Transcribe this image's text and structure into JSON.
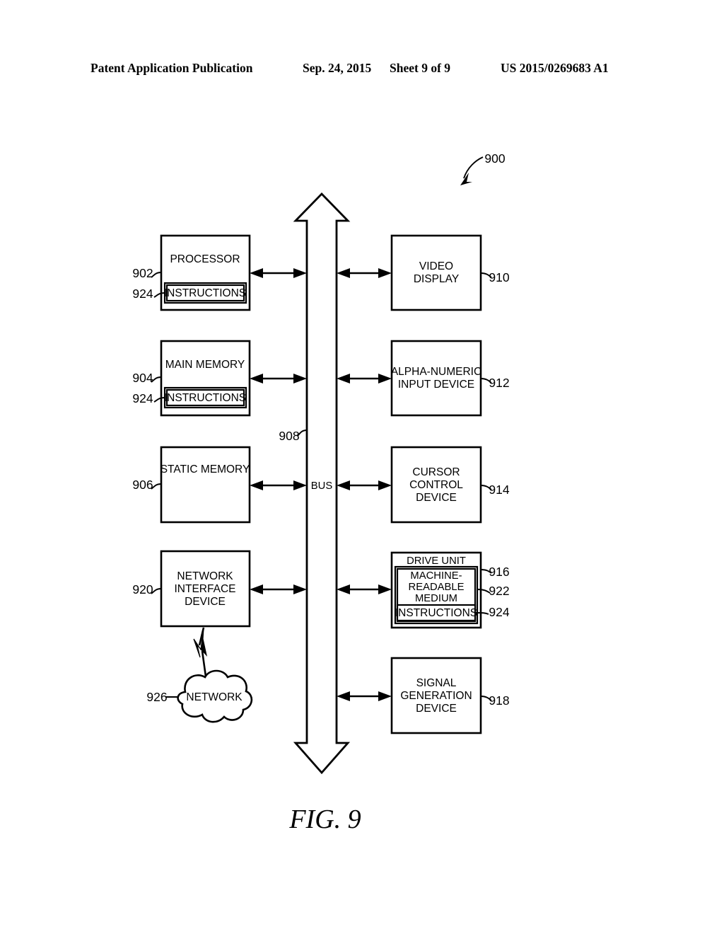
{
  "header": {
    "publication": "Patent Application Publication",
    "date": "Sep. 24, 2015",
    "sheet": "Sheet 9 of 9",
    "patent_number": "US 2015/0269683 A1"
  },
  "figure": {
    "caption": "FIG. 9",
    "system_ref": "900",
    "bus_label": "BUS",
    "bus_ref": "908"
  },
  "left_column": [
    {
      "title": "PROCESSOR",
      "ref": "902",
      "inner_label": "INSTRUCTIONS",
      "inner_ref": "924"
    },
    {
      "title": "MAIN MEMORY",
      "ref": "904",
      "inner_label": "INSTRUCTIONS",
      "inner_ref": "924"
    },
    {
      "title": "STATIC MEMORY",
      "ref": "906"
    },
    {
      "title_line1": "NETWORK",
      "title_line2": "INTERFACE",
      "title_line3": "DEVICE",
      "ref": "920"
    }
  ],
  "right_column": [
    {
      "title_line1": "VIDEO",
      "title_line2": "DISPLAY",
      "ref": "910"
    },
    {
      "title_line1": "ALPHA-NUMERIC",
      "title_line2": "INPUT DEVICE",
      "ref": "912"
    },
    {
      "title_line1": "CURSOR",
      "title_line2": "CONTROL",
      "title_line3": "DEVICE",
      "ref": "914"
    },
    {
      "title": "DRIVE UNIT",
      "ref": "916",
      "medium_line1": "MACHINE-",
      "medium_line2": "READABLE",
      "medium_line3": "MEDIUM",
      "medium_ref": "922",
      "instructions_label": "INSTRUCTIONS",
      "instructions_ref": "924"
    },
    {
      "title_line1": "SIGNAL",
      "title_line2": "GENERATION",
      "title_line3": "DEVICE",
      "ref": "918"
    }
  ],
  "network": {
    "label": "NETWORK",
    "ref": "926"
  }
}
